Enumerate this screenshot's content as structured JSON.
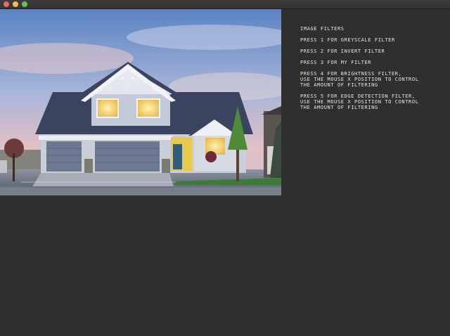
{
  "window": {
    "buttons": [
      "close",
      "minimize",
      "maximize"
    ]
  },
  "image": {
    "subject": "suburban house at dusk"
  },
  "instructions": {
    "title": "IMAGE FILTERS",
    "items": [
      "PRESS 1 FOR GREYSCALE FILTER",
      "PRESS 2 FOR INVERT FILTER",
      "PRESS 3 FOR MY FILTER",
      "PRESS 4 FOR BRIGHTNESS FILTER,\nUSE THE MOUSE X POSITION TO CONTROL\nTHE AMOUNT OF FILTERING",
      "PRESS 5 FOR EDGE DETECTION FILTER,\nUSE THE MOUSE X POSITION TO CONTROL\nTHE AMOUNT OF FILTERING"
    ]
  },
  "colors": {
    "background": "#2f2f2f",
    "text": "#e6e6e6"
  }
}
